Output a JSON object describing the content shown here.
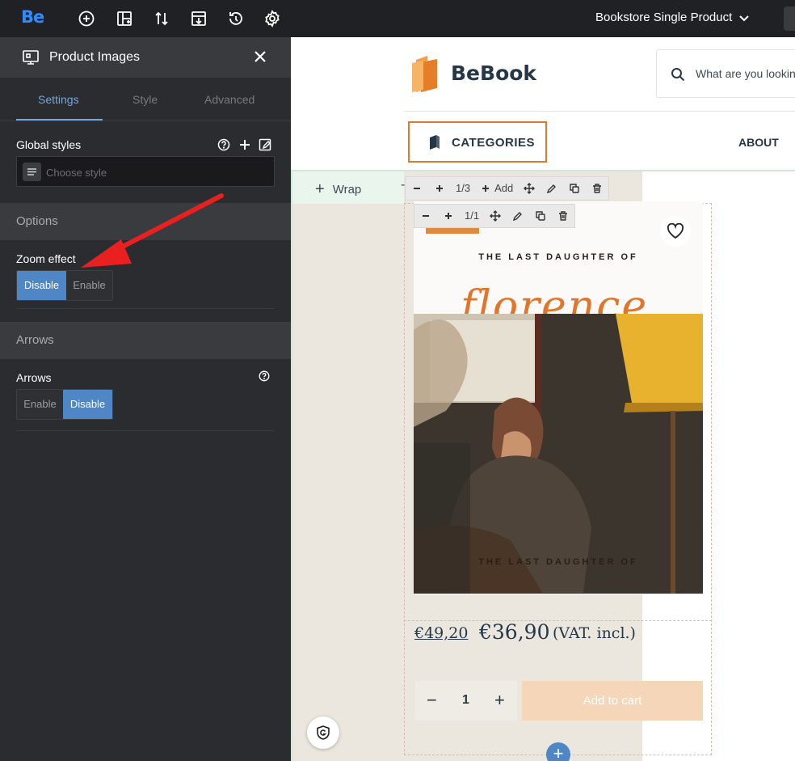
{
  "topbar": {
    "logo": "Be",
    "icons": [
      "add-circle-icon",
      "layout-icon",
      "sort-icon",
      "import-icon",
      "history-icon",
      "gear-icon"
    ],
    "page_name": "Bookstore Single Product"
  },
  "sidebar": {
    "panel_title": "Product Images",
    "tabs": [
      {
        "label": "Settings",
        "active": true
      },
      {
        "label": "Style",
        "active": false
      },
      {
        "label": "Advanced",
        "active": false
      }
    ],
    "global_styles_label": "Global styles",
    "choose_style_placeholder": "Choose style",
    "options_section": "Options",
    "zoom_effect": {
      "label": "Zoom effect",
      "options": [
        "Disable",
        "Enable"
      ],
      "selected": "Disable"
    },
    "arrows_section": "Arrows",
    "arrows": {
      "label": "Arrows",
      "options": [
        "Enable",
        "Disable"
      ],
      "selected": "Disable"
    }
  },
  "canvas": {
    "brand": "BeBook",
    "search_placeholder": "What are you lookin",
    "categories_label": "CATEGORIES",
    "about_label": "ABOUT",
    "wrap_label": "Wrap",
    "toolbar_outer": {
      "counter": "1/3",
      "add": "Add"
    },
    "toolbar_inner": {
      "counter": "1/1"
    },
    "book_subtitle_top": "THE LAST DAUGHTER OF",
    "book_title": "florence",
    "book_subtitle_bottom": "THE LAST DAUGHTER OF",
    "price_old": "€49,20",
    "price_new": "€36,90",
    "price_vat": "(VAT. incl.)",
    "quantity": "1",
    "add_to_cart": "Add to cart",
    "qty_minus": "−",
    "qty_plus": "+",
    "add_section": "+"
  },
  "colors": {
    "accent_blue": "#4f86c6",
    "brand_orange": "#d97a2c",
    "dark_text": "#263847",
    "annotation_arrow": "#e8201f"
  }
}
